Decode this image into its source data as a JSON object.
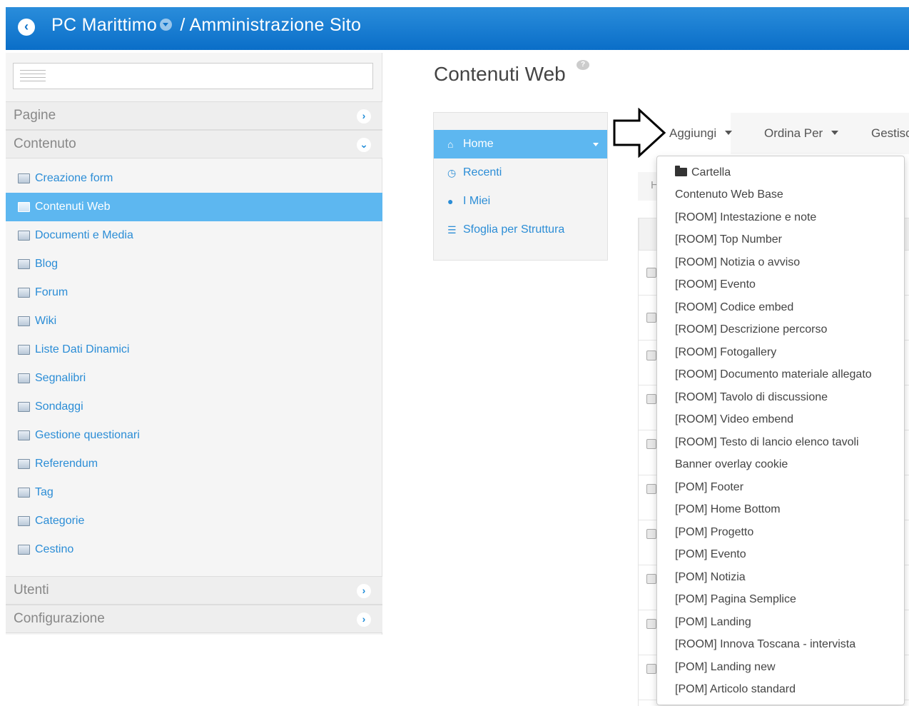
{
  "header": {
    "site_name": "PC Marittimo",
    "separator": "/",
    "section": "Amministrazione Sito"
  },
  "sidebar": {
    "panels": [
      {
        "label": "Pagine"
      },
      {
        "label": "Contenuto"
      },
      {
        "label": "Utenti"
      },
      {
        "label": "Configurazione"
      }
    ],
    "items": [
      {
        "label": "Creazione form"
      },
      {
        "label": "Contenuti Web"
      },
      {
        "label": "Documenti e Media"
      },
      {
        "label": "Blog"
      },
      {
        "label": "Forum"
      },
      {
        "label": "Wiki"
      },
      {
        "label": "Liste Dati Dinamici"
      },
      {
        "label": "Segnalibri"
      },
      {
        "label": "Sondaggi"
      },
      {
        "label": "Gestione questionari"
      },
      {
        "label": "Referendum"
      },
      {
        "label": "Tag"
      },
      {
        "label": "Categorie"
      },
      {
        "label": "Cestino"
      }
    ]
  },
  "main": {
    "title": "Contenuti Web",
    "subnav": [
      {
        "label": "Home"
      },
      {
        "label": "Recenti"
      },
      {
        "label": "I Miei"
      },
      {
        "label": "Sfoglia per Struttura"
      }
    ],
    "toolbar": {
      "add": "Aggiungi",
      "sort": "Ordina Per",
      "manage": "Gestisc"
    },
    "breadcrumb_fragment": "H"
  },
  "add_menu": {
    "items": [
      "Cartella",
      "Contenuto Web Base",
      "[ROOM] Intestazione e note",
      "[ROOM] Top Number",
      "[ROOM] Notizia o avviso",
      "[ROOM] Evento",
      "[ROOM] Codice embed",
      "[ROOM] Descrizione percorso",
      "[ROOM] Fotogallery",
      "[ROOM] Documento materiale allegato",
      "[ROOM] Tavolo di discussione",
      "[ROOM] Video embend",
      "[ROOM] Testo di lancio elenco tavoli",
      "Banner overlay cookie",
      "[POM] Footer",
      "[POM] Home Bottom",
      "[POM] Progetto",
      "[POM] Evento",
      "[POM] Notizia",
      "[POM] Pagina Semplice",
      "[POM] Landing",
      "[ROOM] Innova Toscana - intervista",
      "[POM] Landing new",
      "[POM] Articolo standard"
    ]
  },
  "colors": {
    "topbar": "#0a6ec8",
    "active_item": "#5db7f0",
    "link": "#2b8dd6"
  }
}
